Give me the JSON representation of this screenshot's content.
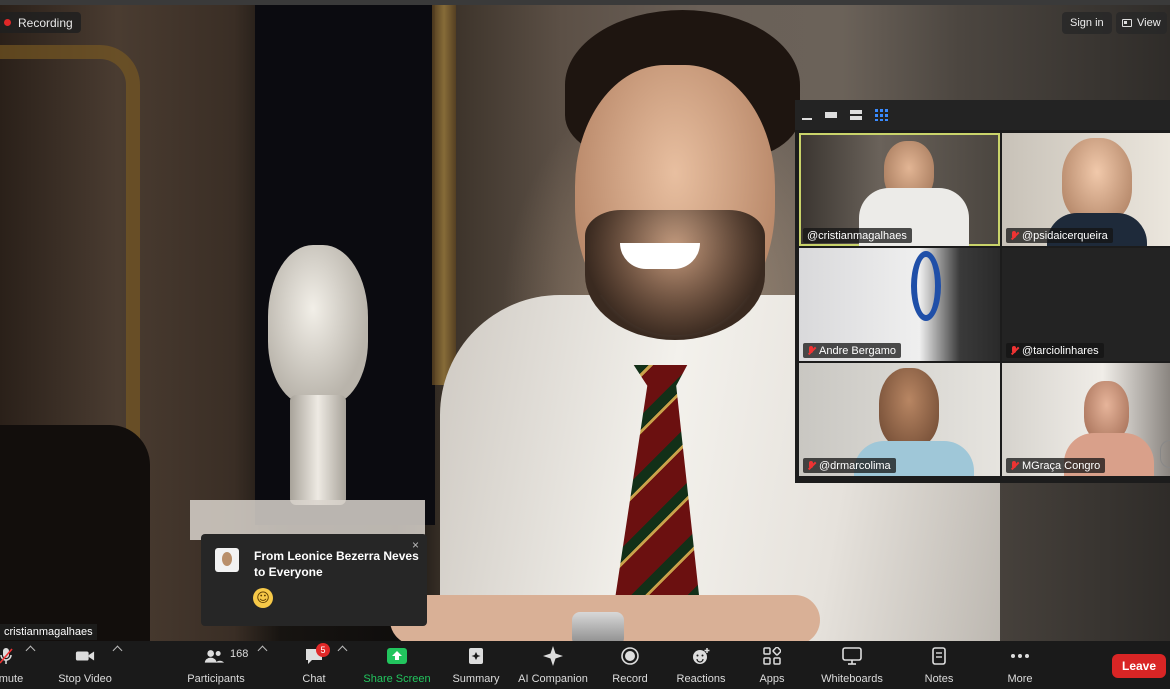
{
  "top_bar": {
    "recording_label": "Recording",
    "sign_in_label": "Sign in",
    "view_label": "View"
  },
  "gallery": {
    "layout_options": [
      "minimize-icon",
      "speaker-strip-icon",
      "side-by-side-icon",
      "gallery-grid-icon"
    ],
    "active_layout": "gallery-grid-icon",
    "tiles": [
      {
        "name": "@cristianmagalhaes",
        "muted": false,
        "active_speaker": true
      },
      {
        "name": "@psidaicerqueira",
        "muted": true
      },
      {
        "name": "Andre Bergamo",
        "muted": true
      },
      {
        "name": "@tarciolinhares",
        "muted": true
      },
      {
        "name": "@drmarcolima",
        "muted": true
      },
      {
        "name": "MGraça Congro",
        "muted": true
      }
    ]
  },
  "chat_toast": {
    "title": "From Leonice Bezerra Neves to Everyone",
    "close": "×",
    "message_emoji": "☺"
  },
  "speaker_name": "cristianmagalhaes",
  "toolbar": {
    "mute": "mute",
    "stop_video": "Stop Video",
    "participants": "Participants",
    "participants_count": "168",
    "chat": "Chat",
    "chat_badge": "5",
    "share_screen": "Share Screen",
    "summary": "Summary",
    "ai_companion": "AI Companion",
    "record": "Record",
    "reactions": "Reactions",
    "apps": "Apps",
    "whiteboards": "Whiteboards",
    "notes": "Notes",
    "more": "More",
    "leave": "Leave"
  },
  "colors": {
    "accent_green": "#22c55e",
    "leave_red": "#d92525",
    "active_border": "#c9d36a",
    "grid_icon_blue": "#3a8bff"
  }
}
